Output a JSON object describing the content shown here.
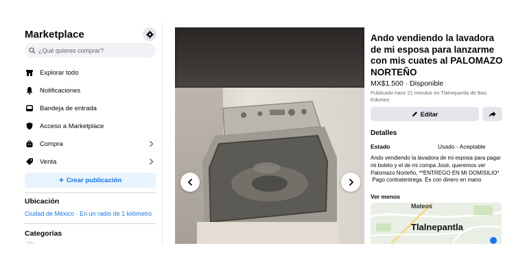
{
  "sidebar": {
    "title": "Marketplace",
    "search_placeholder": "¿Qué quieres comprar?",
    "nav": [
      {
        "label": "Explorar todo",
        "icon": "store-icon"
      },
      {
        "label": "Notificaciones",
        "icon": "bell-icon"
      },
      {
        "label": "Bandeja de entrada",
        "icon": "inbox-icon"
      },
      {
        "label": "Acceso a Marketplace",
        "icon": "shield-icon"
      },
      {
        "label": "Compra",
        "icon": "bag-icon"
      },
      {
        "label": "Venta",
        "icon": "tag-icon"
      }
    ],
    "create_label": "Crear publicación",
    "location_title": "Ubicación",
    "location_value": "Ciudad de México · En un radio de 1 kilómetro",
    "categories_title": "Categorías"
  },
  "listing": {
    "title": "Ando vendiendo la lavadora de mi esposa para lanzarme con mis cuates al PALOMAZO NORTEÑO",
    "price": "MX$1.500 · Disponible",
    "meta": "Publicado hace 21 minutos en Tlalnepantla de Baz, Edomex",
    "edit_label": "Editar",
    "details_title": "Detalles",
    "condition_label": "Estado",
    "condition_value": "Usado - Aceptable",
    "description": "Ando vendiendo la lavadora de mi esposa para pagar mi boleto y el de mi compa José, queremos ver Palomazo Norteño, **ENTREGO EN MI DOMISILIO*\n Pago contratentrega. Es con dinero en mano",
    "see_less": "Ver menos",
    "map_label_1": "Mateos",
    "map_label_2": "Tlalnepantla"
  },
  "colors": {
    "accent": "#1877f2",
    "panel_bg": "#e4e6eb"
  }
}
